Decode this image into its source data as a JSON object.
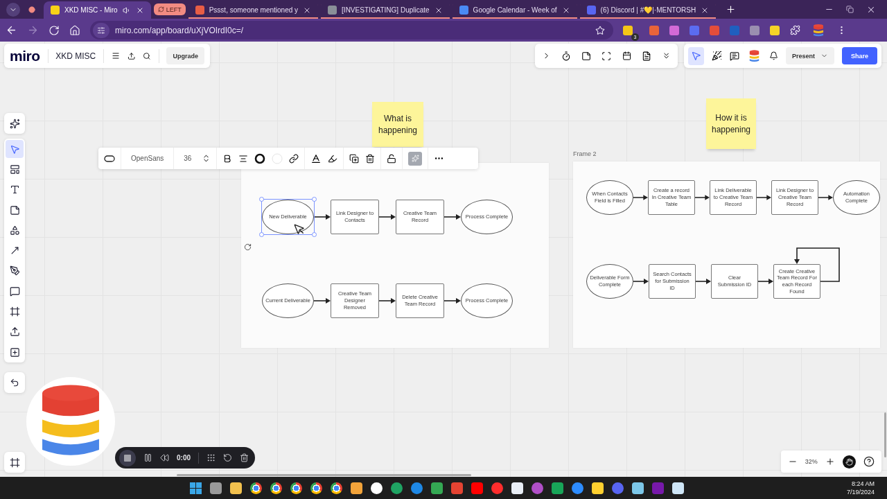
{
  "browser": {
    "tabs": [
      {
        "title": "XKD MISC - Miro",
        "selected": true,
        "audio": true,
        "in_group": false
      },
      {
        "title": "Pssst, someone mentioned y",
        "selected": false,
        "audio": false,
        "in_group": true
      },
      {
        "title": "[INVESTIGATING] Duplicate",
        "selected": false,
        "audio": false,
        "in_group": true
      },
      {
        "title": "Google Calendar - Week of",
        "selected": false,
        "audio": false,
        "in_group": true
      },
      {
        "title": "(6) Discord | #💛|·MENTORSH",
        "selected": false,
        "audio": false,
        "in_group": true
      }
    ],
    "tab_group": "LEFT",
    "url": "miro.com/app/board/uXjVOIrdI0c=/",
    "forward_disabled": true,
    "extension_badge": "3"
  },
  "board": {
    "logo": "miro",
    "name": "XKD MISC",
    "upgrade": "Upgrade",
    "present": "Present",
    "share": "Share",
    "cursors_on": true
  },
  "tools": [
    {
      "kind": "ai",
      "selected": false
    },
    {
      "kind": "select",
      "selected": true
    },
    {
      "kind": "templates",
      "selected": false
    },
    {
      "kind": "text",
      "selected": false
    },
    {
      "kind": "sticky",
      "selected": false
    },
    {
      "kind": "shapes",
      "selected": false
    },
    {
      "kind": "line",
      "selected": false
    },
    {
      "kind": "pen",
      "selected": false
    },
    {
      "kind": "comment",
      "selected": false
    },
    {
      "kind": "frame",
      "selected": false
    },
    {
      "kind": "upload",
      "selected": false
    },
    {
      "kind": "add",
      "selected": false
    }
  ],
  "format_toolbar": {
    "font": "OpenSans",
    "size": "36"
  },
  "frames": [
    {
      "sticky": "What is happening",
      "rows": [
        {
          "nodes": [
            {
              "kind": "oval",
              "label": "New Deliverable",
              "selected": true
            },
            {
              "kind": "rect",
              "label": "Link Designer to Contacts",
              "selected": false
            },
            {
              "kind": "rect",
              "label": "Creative Team Record",
              "selected": false
            },
            {
              "kind": "oval",
              "label": "Process Complete",
              "selected": false
            }
          ]
        },
        {
          "nodes": [
            {
              "kind": "oval",
              "label": "Current Deliverable",
              "selected": false
            },
            {
              "kind": "rect",
              "label": "Creative Team Designer Removed",
              "selected": false
            },
            {
              "kind": "rect",
              "label": "Delete Creative Team Record",
              "selected": false
            },
            {
              "kind": "oval",
              "label": "Process Complete",
              "selected": false
            }
          ]
        }
      ]
    },
    {
      "title": "Frame 2",
      "sticky": "How it is happening",
      "rows": [
        {
          "nodes": [
            {
              "kind": "oval",
              "label": "When Contacts Field is Filled",
              "selected": false
            },
            {
              "kind": "rect",
              "label": "Create a record In Creative Team Table",
              "selected": false
            },
            {
              "kind": "rect",
              "label": "Link Deliverable to Creative Team Record",
              "selected": false
            },
            {
              "kind": "rect",
              "label": "Link Designer to Creative Team Record",
              "selected": false
            },
            {
              "kind": "oval",
              "label": "Automation Complete",
              "selected": false
            }
          ]
        },
        {
          "loop": true,
          "nodes": [
            {
              "kind": "oval",
              "label": "Deliverable Form Complete",
              "selected": false
            },
            {
              "kind": "rect",
              "label": "Search Contacts for Submission ID",
              "selected": false
            },
            {
              "kind": "rect",
              "label": "Clear Submission ID",
              "selected": false
            },
            {
              "kind": "rect",
              "label": "Create Creative Team Record For each Record Found",
              "selected": false
            }
          ]
        }
      ]
    }
  ],
  "recorder": {
    "time": "0:00"
  },
  "zoom": "32%",
  "taskbar": {
    "time": "8:24 AM",
    "date": "7/19/2024"
  }
}
